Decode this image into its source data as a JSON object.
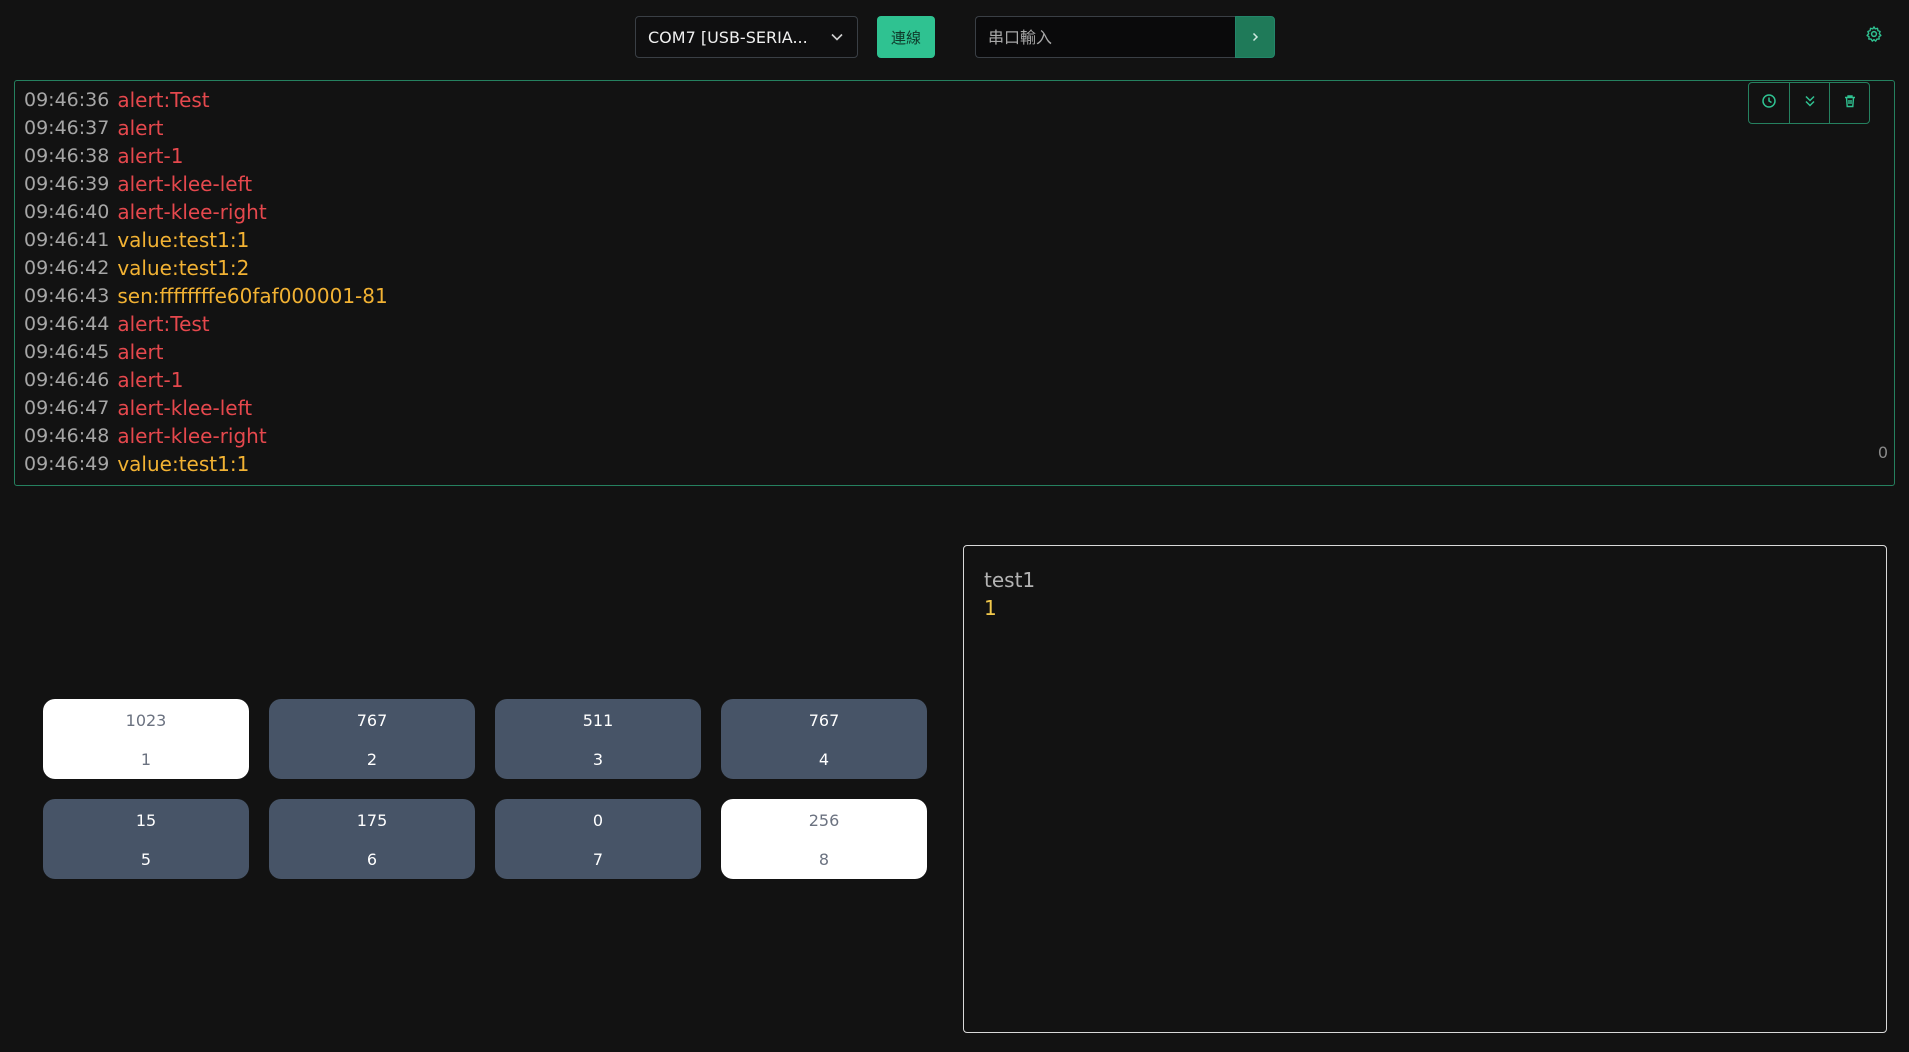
{
  "header": {
    "port_label": "COM7 [USB-SERIA...",
    "connect_label": "連線",
    "input_placeholder": "串口輸入",
    "input_value": ""
  },
  "log": {
    "lines": [
      {
        "time": "09:46:36",
        "text": "alert:Test",
        "level": "alert"
      },
      {
        "time": "09:46:37",
        "text": "alert",
        "level": "alert"
      },
      {
        "time": "09:46:38",
        "text": "alert-1",
        "level": "alert"
      },
      {
        "time": "09:46:39",
        "text": "alert-klee-left",
        "level": "alert"
      },
      {
        "time": "09:46:40",
        "text": "alert-klee-right",
        "level": "alert"
      },
      {
        "time": "09:46:41",
        "text": "value:test1:1",
        "level": "value"
      },
      {
        "time": "09:46:42",
        "text": "value:test1:2",
        "level": "value"
      },
      {
        "time": "09:46:43",
        "text": "sen:ffffffffe60faf000001-81",
        "level": "value"
      },
      {
        "time": "09:46:44",
        "text": "alert:Test",
        "level": "alert"
      },
      {
        "time": "09:46:45",
        "text": "alert",
        "level": "alert"
      },
      {
        "time": "09:46:46",
        "text": "alert-1",
        "level": "alert"
      },
      {
        "time": "09:46:47",
        "text": "alert-klee-left",
        "level": "alert"
      },
      {
        "time": "09:46:48",
        "text": "alert-klee-right",
        "level": "alert"
      },
      {
        "time": "09:46:49",
        "text": "value:test1:1",
        "level": "value"
      }
    ],
    "count": "0",
    "tools": [
      "clock-icon",
      "chevrons-down-icon",
      "trash-icon"
    ]
  },
  "buttons": [
    {
      "value": "1023",
      "label": "1",
      "active": true
    },
    {
      "value": "767",
      "label": "2",
      "active": false
    },
    {
      "value": "511",
      "label": "3",
      "active": false
    },
    {
      "value": "767",
      "label": "4",
      "active": false
    },
    {
      "value": "15",
      "label": "5",
      "active": false
    },
    {
      "value": "175",
      "label": "6",
      "active": false
    },
    {
      "value": "0",
      "label": "7",
      "active": false
    },
    {
      "value": "256",
      "label": "8",
      "active": true
    }
  ],
  "values_panel": {
    "name": "test1",
    "value": "1"
  },
  "colors": {
    "accent": "#2fc291",
    "alert": "#e5484d",
    "value": "#f2b233",
    "card_dark": "#475467"
  }
}
